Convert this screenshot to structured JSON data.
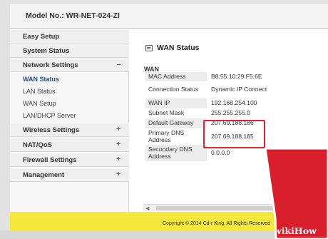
{
  "header": {
    "model_label": "Model No.:",
    "model_value": "WR-NET-024-ZI"
  },
  "sidebar": {
    "main": [
      {
        "label": "Easy Setup",
        "sign": ""
      },
      {
        "label": "System Status",
        "sign": ""
      },
      {
        "label": "Network Settings",
        "sign": "–"
      },
      {
        "label": "Wireless Settings",
        "sign": "+"
      },
      {
        "label": "NAT/QoS",
        "sign": "+"
      },
      {
        "label": "Firewall Settings",
        "sign": "+"
      },
      {
        "label": "Management",
        "sign": "+"
      }
    ],
    "sub": [
      "WAN Status",
      "LAN Status",
      "WAN Setup",
      "LAN/DHCP Server"
    ]
  },
  "main": {
    "title": "WAN Status",
    "section": "WAN",
    "rows": [
      {
        "label": "MAC Address",
        "value": "B8:55:10:29:F5:6E"
      },
      {
        "label": "Connection Status",
        "value": "Dynamic IP Connect"
      },
      {
        "label": "WAN IP",
        "value": "192.168.254.100"
      },
      {
        "label": "Subnet Mask",
        "value": "255.255.255.0"
      },
      {
        "label": "Default Gateway",
        "value": "207.69.188.186"
      },
      {
        "label": "Primary DNS Address",
        "value": "207.69.188.185"
      },
      {
        "label": "Secondary DNS Address",
        "value": "0.0.0.0"
      }
    ]
  },
  "footer": {
    "copyright": "Copyright © 2014 Cd-r King. All Rights Reserved"
  },
  "watermark": {
    "part1": "wiki",
    "part2": "How"
  },
  "colors": {
    "footer": "#f5e83a",
    "highlight": "#d9252f",
    "active_link": "#1a4f8a"
  },
  "icons": {
    "title": "page-icon"
  }
}
